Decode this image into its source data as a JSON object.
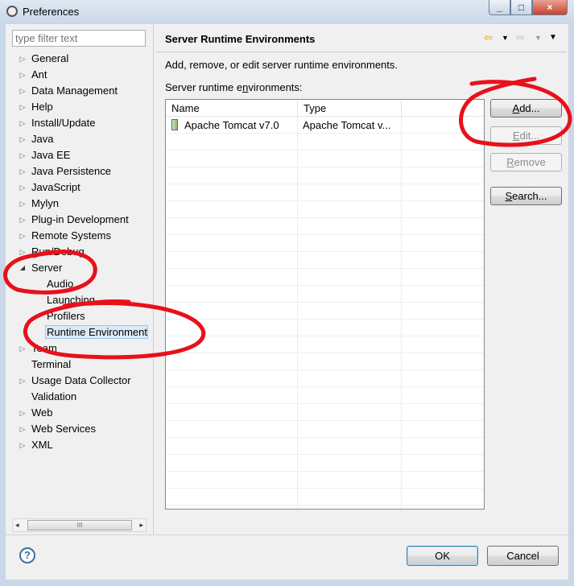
{
  "window": {
    "title": "Preferences",
    "buttons": [
      "_",
      "□",
      "×"
    ]
  },
  "filter": {
    "placeholder": "type filter text"
  },
  "tree": [
    {
      "label": "General",
      "arrow": "▷"
    },
    {
      "label": "Ant",
      "arrow": "▷"
    },
    {
      "label": "Data Management",
      "arrow": "▷"
    },
    {
      "label": "Help",
      "arrow": "▷"
    },
    {
      "label": "Install/Update",
      "arrow": "▷"
    },
    {
      "label": "Java",
      "arrow": "▷"
    },
    {
      "label": "Java EE",
      "arrow": "▷"
    },
    {
      "label": "Java Persistence",
      "arrow": "▷"
    },
    {
      "label": "JavaScript",
      "arrow": "▷"
    },
    {
      "label": "Mylyn",
      "arrow": "▷"
    },
    {
      "label": "Plug-in Development",
      "arrow": "▷"
    },
    {
      "label": "Remote Systems",
      "arrow": "▷"
    },
    {
      "label": "Run/Debug",
      "arrow": "▷"
    },
    {
      "label": "Server",
      "arrow": "◢"
    },
    {
      "label": "Audio",
      "arrow": ""
    },
    {
      "label": "Launching",
      "arrow": ""
    },
    {
      "label": "Profilers",
      "arrow": ""
    },
    {
      "label": "Runtime Environment",
      "arrow": ""
    },
    {
      "label": "Team",
      "arrow": "▷"
    },
    {
      "label": "Terminal",
      "arrow": ""
    },
    {
      "label": "Usage Data Collector",
      "arrow": "▷"
    },
    {
      "label": "Validation",
      "arrow": ""
    },
    {
      "label": "Web",
      "arrow": "▷"
    },
    {
      "label": "Web Services",
      "arrow": "▷"
    },
    {
      "label": "XML",
      "arrow": "▷"
    }
  ],
  "scrollbar": {
    "left_arrow": "◂",
    "right_arrow": "▸",
    "grip": "III"
  },
  "page": {
    "title": "Server Runtime Environments",
    "nav": {
      "back": "⇦",
      "dropdown": "▼",
      "forward": "⇨",
      "menu": "▼"
    },
    "description": "Add, remove, or edit server runtime environments.",
    "table_label_pre": "Server runtime e",
    "table_label_ul": "n",
    "table_label_post": "vironments:",
    "table": {
      "columns": [
        "Name",
        "Type"
      ],
      "rows": [
        {
          "name": "Apache Tomcat v7.0",
          "type": "Apache Tomcat v..."
        }
      ]
    },
    "buttons": {
      "add": {
        "ul": "A",
        "rest": "dd..."
      },
      "edit": {
        "ul": "E",
        "rest": "dit..."
      },
      "remove": {
        "ul": "R",
        "rest": "emove"
      },
      "search": {
        "ul": "S",
        "rest": "earch..."
      }
    }
  },
  "footer": {
    "help": "?",
    "ok": "OK",
    "cancel": "Cancel"
  },
  "colors": {
    "annotation": "#e8101a",
    "selection": "#dbe9f8"
  }
}
